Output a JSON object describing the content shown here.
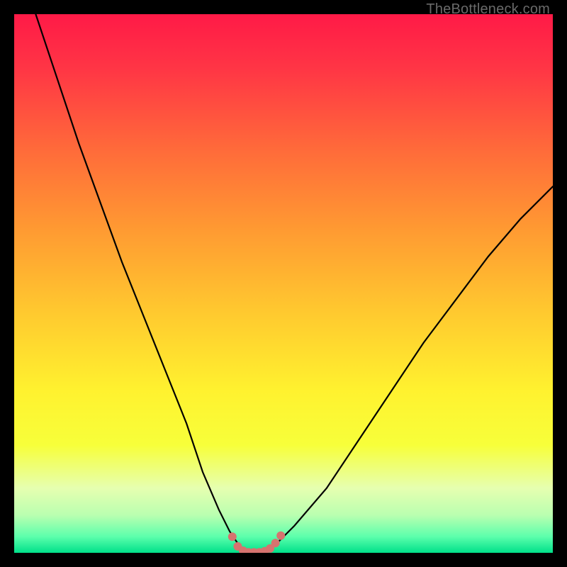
{
  "watermark": {
    "text": "TheBottleneck.com"
  },
  "colors": {
    "frame_bg": "#000000",
    "curve": "#000000",
    "marker": "#d6736f",
    "gradient_stops": [
      {
        "offset": 0.0,
        "color": "#ff1a47"
      },
      {
        "offset": 0.1,
        "color": "#ff3545"
      },
      {
        "offset": 0.25,
        "color": "#ff6a3a"
      },
      {
        "offset": 0.4,
        "color": "#ff9a32"
      },
      {
        "offset": 0.55,
        "color": "#ffc82f"
      },
      {
        "offset": 0.7,
        "color": "#fff22f"
      },
      {
        "offset": 0.8,
        "color": "#f7ff3a"
      },
      {
        "offset": 0.88,
        "color": "#e6ffb0"
      },
      {
        "offset": 0.93,
        "color": "#baffb0"
      },
      {
        "offset": 0.97,
        "color": "#5cffac"
      },
      {
        "offset": 1.0,
        "color": "#00e08a"
      }
    ]
  },
  "chart_data": {
    "type": "line",
    "title": "",
    "xlabel": "",
    "ylabel": "",
    "xlim": [
      0,
      100
    ],
    "ylim": [
      0,
      100
    ],
    "series": [
      {
        "name": "bottleneck-curve",
        "x": [
          4,
          8,
          12,
          16,
          20,
          24,
          28,
          32,
          35,
          38,
          40,
          42,
          44,
          46,
          48,
          52,
          58,
          64,
          70,
          76,
          82,
          88,
          94,
          100
        ],
        "y": [
          100,
          88,
          76,
          65,
          54,
          44,
          34,
          24,
          15,
          8,
          4,
          1,
          0,
          0,
          1,
          5,
          12,
          21,
          30,
          39,
          47,
          55,
          62,
          68
        ]
      }
    ],
    "markers": {
      "name": "optimal-range-markers",
      "x": [
        40.5,
        41.5,
        42.5,
        43.5,
        44.5,
        45.5,
        46.5,
        47.5,
        48.5,
        49.5
      ],
      "y": [
        3.0,
        1.2,
        0.4,
        0.1,
        0.1,
        0.1,
        0.3,
        0.8,
        1.8,
        3.2
      ]
    }
  }
}
